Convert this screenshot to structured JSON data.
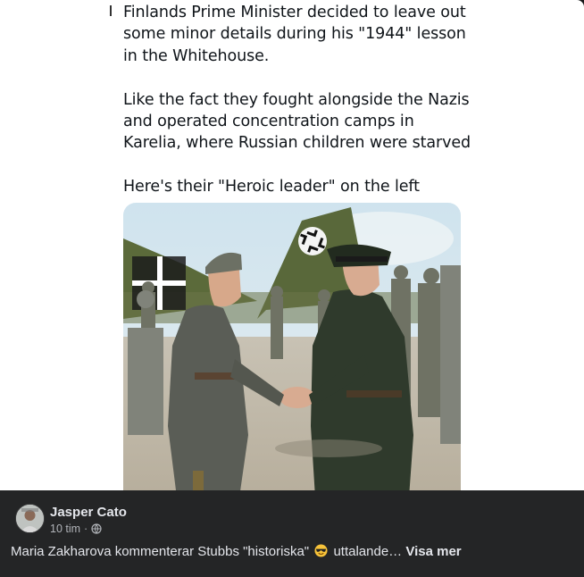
{
  "tweet": {
    "line1": "Finlands Prime Minister decided to leave out",
    "line2": "some minor details during his \"1944\" lesson",
    "line3": "in the Whitehouse.",
    "line4": "Like the fact they fought  alongside the Nazis",
    "line5": "and operated concentration camps in",
    "line6": "Karelia, where Russian children were starved",
    "line7": "Here's their \"Heroic leader\" on the left"
  },
  "photo": {
    "description_icon": "historical-photo"
  },
  "post": {
    "author": "Jasper Cato",
    "time": "10 tim",
    "separator": "·",
    "privacy_icon": "globe-icon",
    "caption_start": "Maria Zakharova kommenterar Stubbs \"historiska\"",
    "caption_emoji": "sunglasses-emoji",
    "caption_end": "uttalande…",
    "see_more": "Visa mer"
  },
  "colors": {
    "footer_bg": "#242526",
    "text_primary": "#e4e6eb",
    "text_secondary": "#b0b3b8"
  }
}
